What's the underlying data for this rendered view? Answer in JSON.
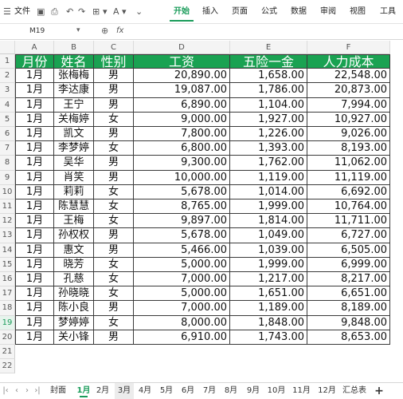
{
  "toolbar": {
    "menu_label": "文件",
    "tabs": [
      "开始",
      "插入",
      "页面",
      "公式",
      "数据",
      "审阅",
      "视图",
      "工具"
    ],
    "active_tab": "开始"
  },
  "formula_bar": {
    "name_box": "M19",
    "fx": "fx",
    "formula": ""
  },
  "columns": [
    "A",
    "B",
    "C",
    "D",
    "E",
    "F"
  ],
  "header": [
    "月份",
    "姓名",
    "性别",
    "工资",
    "五险一金",
    "人力成本"
  ],
  "rows": [
    [
      "1月",
      "张梅梅",
      "男",
      "20,890.00",
      "1,658.00",
      "22,548.00"
    ],
    [
      "1月",
      "李达康",
      "男",
      "19,087.00",
      "1,786.00",
      "20,873.00"
    ],
    [
      "1月",
      "王宁",
      "男",
      "6,890.00",
      "1,104.00",
      "7,994.00"
    ],
    [
      "1月",
      "关梅婷",
      "女",
      "9,000.00",
      "1,927.00",
      "10,927.00"
    ],
    [
      "1月",
      "凯文",
      "男",
      "7,800.00",
      "1,226.00",
      "9,026.00"
    ],
    [
      "1月",
      "李梦婷",
      "女",
      "6,800.00",
      "1,393.00",
      "8,193.00"
    ],
    [
      "1月",
      "吴华",
      "男",
      "9,300.00",
      "1,762.00",
      "11,062.00"
    ],
    [
      "1月",
      "肖笑",
      "男",
      "10,000.00",
      "1,119.00",
      "11,119.00"
    ],
    [
      "1月",
      "莉莉",
      "女",
      "5,678.00",
      "1,014.00",
      "6,692.00"
    ],
    [
      "1月",
      "陈慧慧",
      "女",
      "8,765.00",
      "1,999.00",
      "10,764.00"
    ],
    [
      "1月",
      "王梅",
      "女",
      "9,897.00",
      "1,814.00",
      "11,711.00"
    ],
    [
      "1月",
      "孙权权",
      "男",
      "5,678.00",
      "1,049.00",
      "6,727.00"
    ],
    [
      "1月",
      "惠文",
      "男",
      "5,466.00",
      "1,039.00",
      "6,505.00"
    ],
    [
      "1月",
      "晓芳",
      "女",
      "5,000.00",
      "1,999.00",
      "6,999.00"
    ],
    [
      "1月",
      "孔慈",
      "女",
      "7,000.00",
      "1,217.00",
      "8,217.00"
    ],
    [
      "1月",
      "孙晓晓",
      "女",
      "5,000.00",
      "1,651.00",
      "6,651.00"
    ],
    [
      "1月",
      "陈小良",
      "男",
      "7,000.00",
      "1,189.00",
      "8,189.00"
    ],
    [
      "1月",
      "梦婷婷",
      "女",
      "8,000.00",
      "1,848.00",
      "9,848.00"
    ],
    [
      "1月",
      "关小锋",
      "男",
      "6,910.00",
      "1,743.00",
      "8,653.00"
    ]
  ],
  "row_numbers": [
    "1",
    "2",
    "3",
    "4",
    "5",
    "6",
    "7",
    "8",
    "9",
    "10",
    "11",
    "12",
    "13",
    "14",
    "15",
    "16",
    "17",
    "18",
    "19",
    "20",
    "21",
    "22"
  ],
  "sheets": [
    "封面",
    "1月",
    "2月",
    "3月",
    "4月",
    "5月",
    "6月",
    "7月",
    "8月",
    "9月",
    "10月",
    "11月",
    "12月",
    "汇总表"
  ],
  "active_sheet": "1月",
  "add_sheet": "+",
  "colors": {
    "header_fill": "#1aa252",
    "accent": "#1a9c5a"
  }
}
